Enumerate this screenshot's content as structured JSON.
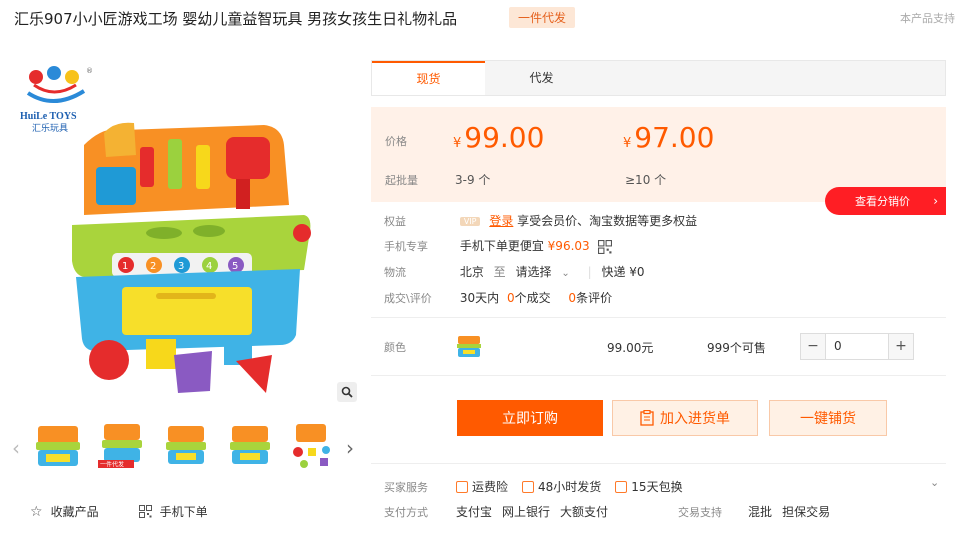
{
  "header": {
    "title": "汇乐907小小匠游戏工场 婴幼儿童益智玩具 男孩女孩生日礼物礼品",
    "badge": "一件代发",
    "support_text": "本产品支持"
  },
  "gallery": {
    "brand_en": "HuiLe TOYS",
    "brand_cn": "汇乐玩具",
    "thumb_badge": "一件代发",
    "number_keys": [
      "1",
      "2",
      "3",
      "4",
      "5"
    ]
  },
  "tabs": [
    {
      "label": "现货",
      "active": true
    },
    {
      "label": "代发",
      "active": false
    }
  ],
  "pricing": {
    "price_label": "价格",
    "qty_label": "起批量",
    "tiers": [
      {
        "currency": "¥",
        "price": "99.00",
        "qty": "3-9 个"
      },
      {
        "currency": "¥",
        "price": "97.00",
        "qty": "≥10 个"
      }
    ],
    "distributor_button": "查看分销价",
    "distributor_chevron": "›"
  },
  "info": {
    "rights_label": "权益",
    "vip_badge": "VIP",
    "login_link": "登录",
    "rights_text": "享受会员价、淘宝数据等更多权益",
    "mobile_label": "手机专享",
    "mobile_text": "手机下单更便宜",
    "mobile_price": "¥96.03",
    "logistics_label": "物流",
    "from_city": "北京",
    "to_word": "至",
    "select_placeholder": "请选择",
    "express_text": "快递 ¥0",
    "deals_label": "成交\\评价",
    "deals_prefix": "30天内",
    "deals_count": "0",
    "deals_suffix": "个成交",
    "reviews_count": "0",
    "reviews_suffix": "条评价"
  },
  "color_row": {
    "label": "颜色",
    "price": "99.00元",
    "stock": "999个可售",
    "minus": "−",
    "quantity": "0",
    "plus": "+"
  },
  "actions": {
    "buy": "立即订购",
    "cart": "加入进货单",
    "shop": "一键铺货"
  },
  "services": {
    "buyer_label": "买家服务",
    "items": [
      "运费险",
      "48小时发货",
      "15天包换"
    ],
    "pay_label": "支付方式",
    "pay_methods": [
      "支付宝",
      "网上银行",
      "大额支付"
    ],
    "trade_label": "交易支持",
    "trade_methods": [
      "混批",
      "担保交易"
    ]
  },
  "bottom_links": {
    "favorite": "收藏产品",
    "mobile_order": "手机下单"
  },
  "colors": {
    "accent": "#ff5a00",
    "red_button": "#ff1e24",
    "price_bg": "#fff1e8"
  }
}
